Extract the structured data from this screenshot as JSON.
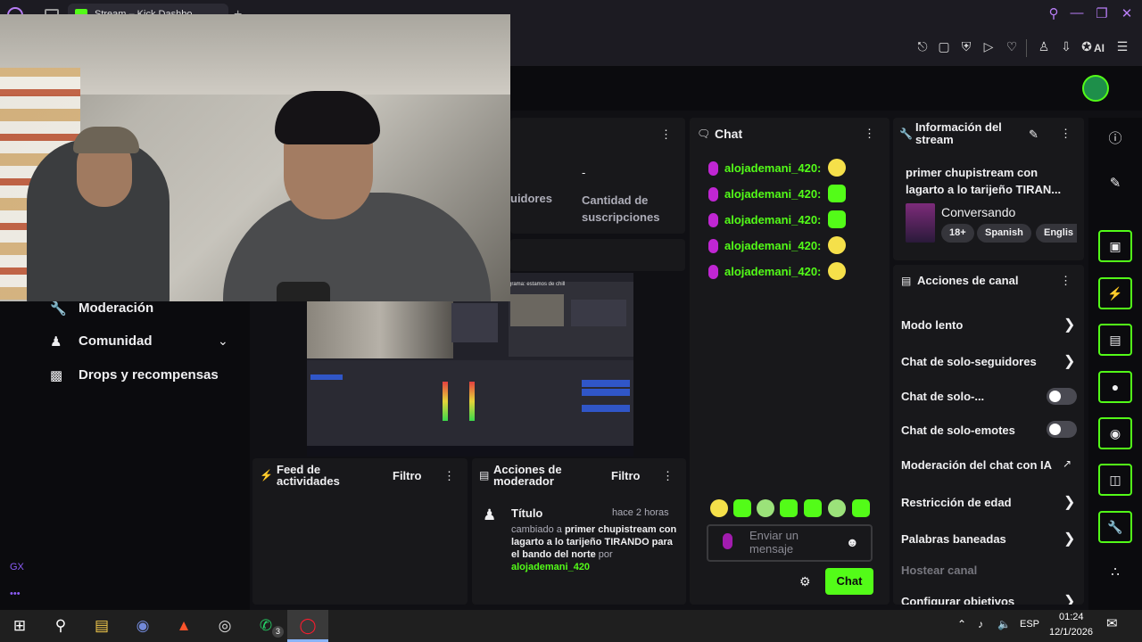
{
  "browser": {
    "tab_title": "Stream – Kick Dashbo",
    "new_tab": "+",
    "window_controls": [
      "search-icon",
      "minimize-icon",
      "restore-icon",
      "close-icon"
    ],
    "toolbar_icons": [
      "pin-icon",
      "screenshot-icon",
      "shield-icon",
      "play-icon",
      "heart-icon",
      "wallet-icon",
      "download-icon",
      "translate-icon",
      "menu-icon"
    ],
    "ai_label": "AI"
  },
  "sidebar": {
    "items": [
      {
        "label": "Moderación",
        "icon": "wrench-icon"
      },
      {
        "label": "Comunidad",
        "icon": "people-icon"
      },
      {
        "label": "Drops y recompensas",
        "icon": "drops-icon"
      }
    ],
    "gx_label": "GX",
    "dots_label": "•••"
  },
  "stats": {
    "followers_label": "uidores",
    "subs_value": "-",
    "subs_label": "Cantidad de suscripciones"
  },
  "preview": {
    "window_title": "grama: estamos de chill"
  },
  "chat": {
    "title": "Chat",
    "messages": [
      {
        "user": "alojademani_420:",
        "emote": "yellow"
      },
      {
        "user": "alojademani_420:",
        "emote": "green"
      },
      {
        "user": "alojademani_420:",
        "emote": "green"
      },
      {
        "user": "alojademani_420:",
        "emote": "yellow"
      },
      {
        "user": "alojademani_420:",
        "emote": "yellow"
      }
    ],
    "input_placeholder": "Enviar un mensaje",
    "send_label": "Chat"
  },
  "stream_info": {
    "title": "Información del stream",
    "stream_title": "primer chupistream con lagarto a lo tarijeño TIRAN...",
    "category": "Conversando",
    "tags": [
      "18+",
      "Spanish",
      "Englis"
    ]
  },
  "channel_actions": {
    "title": "Acciones de canal",
    "items": [
      {
        "label": "Modo lento",
        "control": "chevron"
      },
      {
        "label": "Chat de solo-seguidores",
        "control": "chevron"
      },
      {
        "label": "Chat de solo-...",
        "control": "toggle",
        "on": false
      },
      {
        "label": "Chat de solo-emotes",
        "control": "toggle",
        "on": false
      },
      {
        "label": "Moderación del chat con IA",
        "control": "external"
      },
      {
        "label": "Restricción de edad",
        "control": "chevron"
      },
      {
        "label": "Palabras baneadas",
        "control": "chevron"
      },
      {
        "label": "Hostear canal",
        "control": "none"
      },
      {
        "label": "Configurar objetivos",
        "control": "chevron"
      }
    ]
  },
  "rail": {
    "icons": [
      "info-icon",
      "edit-icon",
      "fullscreen-icon",
      "lightning-icon",
      "notes-icon",
      "chat-bubble-icon",
      "broadcast-icon",
      "layout-icon",
      "wrench-icon",
      "apps-icon"
    ]
  },
  "feed": {
    "title": "Feed de actividades",
    "filter": "Filtro"
  },
  "mod_actions": {
    "title": "Acciones de moderador",
    "filter": "Filtro",
    "entry_title": "Título",
    "entry_time": "hace 2 horas",
    "entry_prefix": "cambiado a",
    "entry_value": "primer chupistream con lagarto a lo tarijeño TIRANDO para el bando del norte",
    "entry_by": "por",
    "entry_user": "alojademani_420"
  },
  "taskbar": {
    "apps": [
      "windows-icon",
      "search-icon",
      "explorer-icon",
      "discord-icon",
      "brave-icon",
      "obs-icon",
      "whatsapp-icon",
      "opera-icon"
    ],
    "whatsapp_badge": "3",
    "language": "ESP",
    "time": "01:24",
    "date": "12/1/2026"
  },
  "colors": {
    "accent": "#53fc18",
    "panel": "#18181b",
    "background": "#0b0b0e",
    "browser_accent": "#b77df5"
  }
}
